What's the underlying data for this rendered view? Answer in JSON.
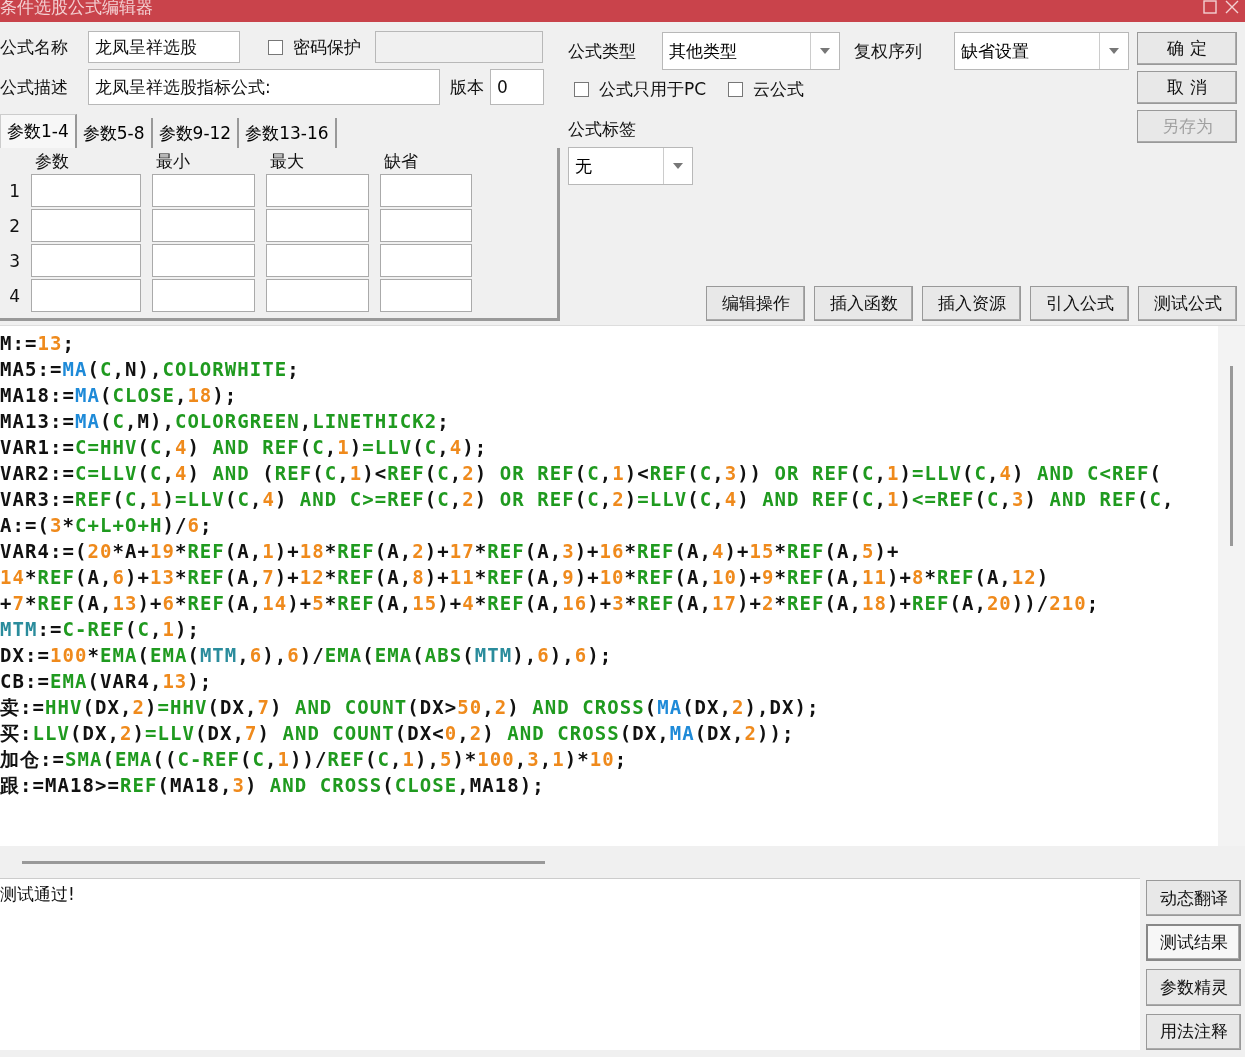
{
  "window": {
    "title": "条件选股公式编辑器"
  },
  "form": {
    "name_label": "公式名称",
    "name_value": "龙凤呈祥选股",
    "password": {
      "label": "密码保护",
      "checked": false
    },
    "desc_label": "公式描述",
    "desc_value": "龙凤呈祥选股指标公式:",
    "version_label": "版本",
    "version_value": "0",
    "type_label": "公式类型",
    "type_value": "其他类型",
    "rights_label": "复权序列",
    "rights_value": "缺省设置",
    "options": [
      {
        "label": "公式只用于PC",
        "checked": false
      },
      {
        "label": "云公式",
        "checked": false
      }
    ],
    "tag_label": "公式标签",
    "tag_value": "无"
  },
  "action_buttons": [
    {
      "label": "确 定",
      "disabled": false
    },
    {
      "label": "取 消",
      "disabled": false
    },
    {
      "label": "另存为",
      "disabled": true
    }
  ],
  "tabs": [
    {
      "label": "参数1-4",
      "selected": true
    },
    {
      "label": "参数5-8",
      "selected": false
    },
    {
      "label": "参数9-12",
      "selected": false
    },
    {
      "label": "参数13-16",
      "selected": false
    }
  ],
  "params": {
    "columns": [
      "参数",
      "最小",
      "最大",
      "缺省"
    ],
    "rows": [
      {
        "number": "1"
      },
      {
        "number": "2"
      },
      {
        "number": "3"
      },
      {
        "number": "4"
      }
    ]
  },
  "tool_buttons": [
    "编辑操作",
    "插入函数",
    "插入资源",
    "引入公式",
    "测试公式"
  ],
  "code_lines": [
    {
      "segments": [
        {
          "kind": "t",
          "text": "M:="
        },
        {
          "kind": "n",
          "text": "13"
        },
        {
          "kind": "t",
          "text": ";"
        }
      ]
    },
    {
      "segments": [
        {
          "kind": "t",
          "text": "MA5:="
        },
        {
          "kind": "m",
          "text": "MA"
        },
        {
          "kind": "t",
          "text": "("
        },
        {
          "kind": "f",
          "text": "C"
        },
        {
          "kind": "t",
          "text": ",N),"
        },
        {
          "kind": "f",
          "text": "COLORWHITE"
        },
        {
          "kind": "t",
          "text": ";"
        }
      ]
    },
    {
      "segments": [
        {
          "kind": "t",
          "text": "MA18:="
        },
        {
          "kind": "m",
          "text": "MA"
        },
        {
          "kind": "t",
          "text": "("
        },
        {
          "kind": "f",
          "text": "CLOSE"
        },
        {
          "kind": "t",
          "text": ","
        },
        {
          "kind": "n",
          "text": "18"
        },
        {
          "kind": "t",
          "text": ");"
        }
      ]
    },
    {
      "segments": [
        {
          "kind": "t",
          "text": "MA13:="
        },
        {
          "kind": "m",
          "text": "MA"
        },
        {
          "kind": "t",
          "text": "("
        },
        {
          "kind": "f",
          "text": "C"
        },
        {
          "kind": "t",
          "text": ",M),"
        },
        {
          "kind": "f",
          "text": "COLORGREEN"
        },
        {
          "kind": "t",
          "text": ","
        },
        {
          "kind": "f",
          "text": "LINETHICK2"
        },
        {
          "kind": "t",
          "text": ";"
        }
      ]
    },
    {
      "segments": [
        {
          "kind": "t",
          "text": "VAR1:="
        },
        {
          "kind": "f",
          "text": "C=HHV"
        },
        {
          "kind": "t",
          "text": "("
        },
        {
          "kind": "f",
          "text": "C"
        },
        {
          "kind": "t",
          "text": ","
        },
        {
          "kind": "n",
          "text": "4"
        },
        {
          "kind": "t",
          "text": ") "
        },
        {
          "kind": "f",
          "text": "AND REF"
        },
        {
          "kind": "t",
          "text": "("
        },
        {
          "kind": "f",
          "text": "C"
        },
        {
          "kind": "t",
          "text": ","
        },
        {
          "kind": "n",
          "text": "1"
        },
        {
          "kind": "t",
          "text": ")"
        },
        {
          "kind": "f",
          "text": "=LLV"
        },
        {
          "kind": "t",
          "text": "("
        },
        {
          "kind": "f",
          "text": "C"
        },
        {
          "kind": "t",
          "text": ","
        },
        {
          "kind": "n",
          "text": "4"
        },
        {
          "kind": "t",
          "text": ");"
        }
      ]
    },
    {
      "segments": [
        {
          "kind": "t",
          "text": "VAR2:="
        },
        {
          "kind": "f",
          "text": "C=LLV"
        },
        {
          "kind": "t",
          "text": "("
        },
        {
          "kind": "f",
          "text": "C"
        },
        {
          "kind": "t",
          "text": ","
        },
        {
          "kind": "n",
          "text": "4"
        },
        {
          "kind": "t",
          "text": ") "
        },
        {
          "kind": "f",
          "text": "AND"
        },
        {
          "kind": "t",
          "text": " ("
        },
        {
          "kind": "f",
          "text": "REF"
        },
        {
          "kind": "t",
          "text": "("
        },
        {
          "kind": "f",
          "text": "C"
        },
        {
          "kind": "t",
          "text": ","
        },
        {
          "kind": "n",
          "text": "1"
        },
        {
          "kind": "t",
          "text": ")<"
        },
        {
          "kind": "f",
          "text": "REF"
        },
        {
          "kind": "t",
          "text": "("
        },
        {
          "kind": "f",
          "text": "C"
        },
        {
          "kind": "t",
          "text": ","
        },
        {
          "kind": "n",
          "text": "2"
        },
        {
          "kind": "t",
          "text": ") "
        },
        {
          "kind": "f",
          "text": "OR REF"
        },
        {
          "kind": "t",
          "text": "("
        },
        {
          "kind": "f",
          "text": "C"
        },
        {
          "kind": "t",
          "text": ","
        },
        {
          "kind": "n",
          "text": "1"
        },
        {
          "kind": "t",
          "text": ")<"
        },
        {
          "kind": "f",
          "text": "REF"
        },
        {
          "kind": "t",
          "text": "("
        },
        {
          "kind": "f",
          "text": "C"
        },
        {
          "kind": "t",
          "text": ","
        },
        {
          "kind": "n",
          "text": "3"
        },
        {
          "kind": "t",
          "text": ")) "
        },
        {
          "kind": "f",
          "text": "OR REF"
        },
        {
          "kind": "t",
          "text": "("
        },
        {
          "kind": "f",
          "text": "C"
        },
        {
          "kind": "t",
          "text": ","
        },
        {
          "kind": "n",
          "text": "1"
        },
        {
          "kind": "t",
          "text": ")"
        },
        {
          "kind": "f",
          "text": "=LLV"
        },
        {
          "kind": "t",
          "text": "("
        },
        {
          "kind": "f",
          "text": "C"
        },
        {
          "kind": "t",
          "text": ","
        },
        {
          "kind": "n",
          "text": "4"
        },
        {
          "kind": "t",
          "text": ") "
        },
        {
          "kind": "f",
          "text": "AND C<REF"
        },
        {
          "kind": "t",
          "text": "("
        }
      ]
    },
    {
      "segments": [
        {
          "kind": "t",
          "text": "VAR3:="
        },
        {
          "kind": "f",
          "text": "REF"
        },
        {
          "kind": "t",
          "text": "("
        },
        {
          "kind": "f",
          "text": "C"
        },
        {
          "kind": "t",
          "text": ","
        },
        {
          "kind": "n",
          "text": "1"
        },
        {
          "kind": "t",
          "text": ")"
        },
        {
          "kind": "f",
          "text": "=LLV"
        },
        {
          "kind": "t",
          "text": "("
        },
        {
          "kind": "f",
          "text": "C"
        },
        {
          "kind": "t",
          "text": ","
        },
        {
          "kind": "n",
          "text": "4"
        },
        {
          "kind": "t",
          "text": ") "
        },
        {
          "kind": "f",
          "text": "AND C>=REF"
        },
        {
          "kind": "t",
          "text": "("
        },
        {
          "kind": "f",
          "text": "C"
        },
        {
          "kind": "t",
          "text": ","
        },
        {
          "kind": "n",
          "text": "2"
        },
        {
          "kind": "t",
          "text": ") "
        },
        {
          "kind": "f",
          "text": "OR REF"
        },
        {
          "kind": "t",
          "text": "("
        },
        {
          "kind": "f",
          "text": "C"
        },
        {
          "kind": "t",
          "text": ","
        },
        {
          "kind": "n",
          "text": "2"
        },
        {
          "kind": "t",
          "text": ")"
        },
        {
          "kind": "f",
          "text": "=LLV"
        },
        {
          "kind": "t",
          "text": "("
        },
        {
          "kind": "f",
          "text": "C"
        },
        {
          "kind": "t",
          "text": ","
        },
        {
          "kind": "n",
          "text": "4"
        },
        {
          "kind": "t",
          "text": ") "
        },
        {
          "kind": "f",
          "text": "AND REF"
        },
        {
          "kind": "t",
          "text": "("
        },
        {
          "kind": "f",
          "text": "C"
        },
        {
          "kind": "t",
          "text": ","
        },
        {
          "kind": "n",
          "text": "1"
        },
        {
          "kind": "t",
          "text": ")"
        },
        {
          "kind": "f",
          "text": "<=REF"
        },
        {
          "kind": "t",
          "text": "("
        },
        {
          "kind": "f",
          "text": "C"
        },
        {
          "kind": "t",
          "text": ","
        },
        {
          "kind": "n",
          "text": "3"
        },
        {
          "kind": "t",
          "text": ") "
        },
        {
          "kind": "f",
          "text": "AND REF"
        },
        {
          "kind": "t",
          "text": "("
        },
        {
          "kind": "f",
          "text": "C"
        },
        {
          "kind": "t",
          "text": ","
        }
      ]
    },
    {
      "segments": [
        {
          "kind": "t",
          "text": "A:=("
        },
        {
          "kind": "n",
          "text": "3"
        },
        {
          "kind": "t",
          "text": "*"
        },
        {
          "kind": "f",
          "text": "C+L+O+H"
        },
        {
          "kind": "t",
          "text": ")/"
        },
        {
          "kind": "n",
          "text": "6"
        },
        {
          "kind": "t",
          "text": ";"
        }
      ]
    },
    {
      "segments": [
        {
          "kind": "t",
          "text": "VAR4:=("
        },
        {
          "kind": "n",
          "text": "20"
        },
        {
          "kind": "t",
          "text": "*A+"
        },
        {
          "kind": "n",
          "text": "19"
        },
        {
          "kind": "t",
          "text": "*"
        },
        {
          "kind": "f",
          "text": "REF"
        },
        {
          "kind": "t",
          "text": "(A,"
        },
        {
          "kind": "n",
          "text": "1"
        },
        {
          "kind": "t",
          "text": ")+"
        },
        {
          "kind": "n",
          "text": "18"
        },
        {
          "kind": "t",
          "text": "*"
        },
        {
          "kind": "f",
          "text": "REF"
        },
        {
          "kind": "t",
          "text": "(A,"
        },
        {
          "kind": "n",
          "text": "2"
        },
        {
          "kind": "t",
          "text": ")+"
        },
        {
          "kind": "n",
          "text": "17"
        },
        {
          "kind": "t",
          "text": "*"
        },
        {
          "kind": "f",
          "text": "REF"
        },
        {
          "kind": "t",
          "text": "(A,"
        },
        {
          "kind": "n",
          "text": "3"
        },
        {
          "kind": "t",
          "text": ")+"
        },
        {
          "kind": "n",
          "text": "16"
        },
        {
          "kind": "t",
          "text": "*"
        },
        {
          "kind": "f",
          "text": "REF"
        },
        {
          "kind": "t",
          "text": "(A,"
        },
        {
          "kind": "n",
          "text": "4"
        },
        {
          "kind": "t",
          "text": ")+"
        },
        {
          "kind": "n",
          "text": "15"
        },
        {
          "kind": "t",
          "text": "*"
        },
        {
          "kind": "f",
          "text": "REF"
        },
        {
          "kind": "t",
          "text": "(A,"
        },
        {
          "kind": "n",
          "text": "5"
        },
        {
          "kind": "t",
          "text": ")+"
        }
      ]
    },
    {
      "segments": [
        {
          "kind": "n",
          "text": "14"
        },
        {
          "kind": "t",
          "text": "*"
        },
        {
          "kind": "f",
          "text": "REF"
        },
        {
          "kind": "t",
          "text": "(A,"
        },
        {
          "kind": "n",
          "text": "6"
        },
        {
          "kind": "t",
          "text": ")+"
        },
        {
          "kind": "n",
          "text": "13"
        },
        {
          "kind": "t",
          "text": "*"
        },
        {
          "kind": "f",
          "text": "REF"
        },
        {
          "kind": "t",
          "text": "(A,"
        },
        {
          "kind": "n",
          "text": "7"
        },
        {
          "kind": "t",
          "text": ")+"
        },
        {
          "kind": "n",
          "text": "12"
        },
        {
          "kind": "t",
          "text": "*"
        },
        {
          "kind": "f",
          "text": "REF"
        },
        {
          "kind": "t",
          "text": "(A,"
        },
        {
          "kind": "n",
          "text": "8"
        },
        {
          "kind": "t",
          "text": ")+"
        },
        {
          "kind": "n",
          "text": "11"
        },
        {
          "kind": "t",
          "text": "*"
        },
        {
          "kind": "f",
          "text": "REF"
        },
        {
          "kind": "t",
          "text": "(A,"
        },
        {
          "kind": "n",
          "text": "9"
        },
        {
          "kind": "t",
          "text": ")+"
        },
        {
          "kind": "n",
          "text": "10"
        },
        {
          "kind": "t",
          "text": "*"
        },
        {
          "kind": "f",
          "text": "REF"
        },
        {
          "kind": "t",
          "text": "(A,"
        },
        {
          "kind": "n",
          "text": "10"
        },
        {
          "kind": "t",
          "text": ")+"
        },
        {
          "kind": "n",
          "text": "9"
        },
        {
          "kind": "t",
          "text": "*"
        },
        {
          "kind": "f",
          "text": "REF"
        },
        {
          "kind": "t",
          "text": "(A,"
        },
        {
          "kind": "n",
          "text": "11"
        },
        {
          "kind": "t",
          "text": ")+"
        },
        {
          "kind": "n",
          "text": "8"
        },
        {
          "kind": "t",
          "text": "*"
        },
        {
          "kind": "f",
          "text": "REF"
        },
        {
          "kind": "t",
          "text": "(A,"
        },
        {
          "kind": "n",
          "text": "12"
        },
        {
          "kind": "t",
          "text": ")"
        }
      ]
    },
    {
      "segments": [
        {
          "kind": "t",
          "text": "+"
        },
        {
          "kind": "n",
          "text": "7"
        },
        {
          "kind": "t",
          "text": "*"
        },
        {
          "kind": "f",
          "text": "REF"
        },
        {
          "kind": "t",
          "text": "(A,"
        },
        {
          "kind": "n",
          "text": "13"
        },
        {
          "kind": "t",
          "text": ")+"
        },
        {
          "kind": "n",
          "text": "6"
        },
        {
          "kind": "t",
          "text": "*"
        },
        {
          "kind": "f",
          "text": "REF"
        },
        {
          "kind": "t",
          "text": "(A,"
        },
        {
          "kind": "n",
          "text": "14"
        },
        {
          "kind": "t",
          "text": ")+"
        },
        {
          "kind": "n",
          "text": "5"
        },
        {
          "kind": "t",
          "text": "*"
        },
        {
          "kind": "f",
          "text": "REF"
        },
        {
          "kind": "t",
          "text": "(A,"
        },
        {
          "kind": "n",
          "text": "15"
        },
        {
          "kind": "t",
          "text": ")+"
        },
        {
          "kind": "n",
          "text": "4"
        },
        {
          "kind": "t",
          "text": "*"
        },
        {
          "kind": "f",
          "text": "REF"
        },
        {
          "kind": "t",
          "text": "(A,"
        },
        {
          "kind": "n",
          "text": "16"
        },
        {
          "kind": "t",
          "text": ")+"
        },
        {
          "kind": "n",
          "text": "3"
        },
        {
          "kind": "t",
          "text": "*"
        },
        {
          "kind": "f",
          "text": "REF"
        },
        {
          "kind": "t",
          "text": "(A,"
        },
        {
          "kind": "n",
          "text": "17"
        },
        {
          "kind": "t",
          "text": ")+"
        },
        {
          "kind": "n",
          "text": "2"
        },
        {
          "kind": "t",
          "text": "*"
        },
        {
          "kind": "f",
          "text": "REF"
        },
        {
          "kind": "t",
          "text": "(A,"
        },
        {
          "kind": "n",
          "text": "18"
        },
        {
          "kind": "t",
          "text": ")+"
        },
        {
          "kind": "f",
          "text": "REF"
        },
        {
          "kind": "t",
          "text": "(A,"
        },
        {
          "kind": "n",
          "text": "20"
        },
        {
          "kind": "t",
          "text": "))/"
        },
        {
          "kind": "n",
          "text": "210"
        },
        {
          "kind": "t",
          "text": ";"
        }
      ]
    },
    {
      "segments": [
        {
          "kind": "v",
          "text": "MTM"
        },
        {
          "kind": "t",
          "text": ":="
        },
        {
          "kind": "f",
          "text": "C-REF"
        },
        {
          "kind": "t",
          "text": "("
        },
        {
          "kind": "f",
          "text": "C"
        },
        {
          "kind": "t",
          "text": ","
        },
        {
          "kind": "n",
          "text": "1"
        },
        {
          "kind": "t",
          "text": ");"
        }
      ]
    },
    {
      "segments": [
        {
          "kind": "t",
          "text": "DX:="
        },
        {
          "kind": "n",
          "text": "100"
        },
        {
          "kind": "t",
          "text": "*"
        },
        {
          "kind": "f",
          "text": "EMA"
        },
        {
          "kind": "t",
          "text": "("
        },
        {
          "kind": "f",
          "text": "EMA"
        },
        {
          "kind": "t",
          "text": "("
        },
        {
          "kind": "v",
          "text": "MTM"
        },
        {
          "kind": "t",
          "text": ","
        },
        {
          "kind": "n",
          "text": "6"
        },
        {
          "kind": "t",
          "text": "),"
        },
        {
          "kind": "n",
          "text": "6"
        },
        {
          "kind": "t",
          "text": ")/"
        },
        {
          "kind": "f",
          "text": "EMA"
        },
        {
          "kind": "t",
          "text": "("
        },
        {
          "kind": "f",
          "text": "EMA"
        },
        {
          "kind": "t",
          "text": "("
        },
        {
          "kind": "f",
          "text": "ABS"
        },
        {
          "kind": "t",
          "text": "("
        },
        {
          "kind": "v",
          "text": "MTM"
        },
        {
          "kind": "t",
          "text": "),"
        },
        {
          "kind": "n",
          "text": "6"
        },
        {
          "kind": "t",
          "text": "),"
        },
        {
          "kind": "n",
          "text": "6"
        },
        {
          "kind": "t",
          "text": ");"
        }
      ]
    },
    {
      "segments": [
        {
          "kind": "t",
          "text": "CB:="
        },
        {
          "kind": "f",
          "text": "EMA"
        },
        {
          "kind": "t",
          "text": "(VAR4,"
        },
        {
          "kind": "n",
          "text": "13"
        },
        {
          "kind": "t",
          "text": ");"
        }
      ]
    },
    {
      "segments": [
        {
          "kind": "t",
          "text": "卖:="
        },
        {
          "kind": "f",
          "text": "HHV"
        },
        {
          "kind": "t",
          "text": "(DX,"
        },
        {
          "kind": "n",
          "text": "2"
        },
        {
          "kind": "t",
          "text": ")"
        },
        {
          "kind": "f",
          "text": "=HHV"
        },
        {
          "kind": "t",
          "text": "(DX,"
        },
        {
          "kind": "n",
          "text": "7"
        },
        {
          "kind": "t",
          "text": ") "
        },
        {
          "kind": "f",
          "text": "AND COUNT"
        },
        {
          "kind": "t",
          "text": "(DX>"
        },
        {
          "kind": "n",
          "text": "50"
        },
        {
          "kind": "t",
          "text": ","
        },
        {
          "kind": "n",
          "text": "2"
        },
        {
          "kind": "t",
          "text": ") "
        },
        {
          "kind": "f",
          "text": "AND CROSS"
        },
        {
          "kind": "t",
          "text": "("
        },
        {
          "kind": "m",
          "text": "MA"
        },
        {
          "kind": "t",
          "text": "(DX,"
        },
        {
          "kind": "n",
          "text": "2"
        },
        {
          "kind": "t",
          "text": "),DX);"
        }
      ]
    },
    {
      "segments": [
        {
          "kind": "t",
          "text": "买:"
        },
        {
          "kind": "f",
          "text": "LLV"
        },
        {
          "kind": "t",
          "text": "(DX,"
        },
        {
          "kind": "n",
          "text": "2"
        },
        {
          "kind": "t",
          "text": ")"
        },
        {
          "kind": "f",
          "text": "=LLV"
        },
        {
          "kind": "t",
          "text": "(DX,"
        },
        {
          "kind": "n",
          "text": "7"
        },
        {
          "kind": "t",
          "text": ") "
        },
        {
          "kind": "f",
          "text": "AND COUNT"
        },
        {
          "kind": "t",
          "text": "(DX<"
        },
        {
          "kind": "n",
          "text": "0"
        },
        {
          "kind": "t",
          "text": ","
        },
        {
          "kind": "n",
          "text": "2"
        },
        {
          "kind": "t",
          "text": ") "
        },
        {
          "kind": "f",
          "text": "AND CROSS"
        },
        {
          "kind": "t",
          "text": "(DX,"
        },
        {
          "kind": "m",
          "text": "MA"
        },
        {
          "kind": "t",
          "text": "(DX,"
        },
        {
          "kind": "n",
          "text": "2"
        },
        {
          "kind": "t",
          "text": "));"
        }
      ]
    },
    {
      "segments": [
        {
          "kind": "t",
          "text": "加仓:="
        },
        {
          "kind": "f",
          "text": "SMA"
        },
        {
          "kind": "t",
          "text": "("
        },
        {
          "kind": "f",
          "text": "EMA"
        },
        {
          "kind": "t",
          "text": "(("
        },
        {
          "kind": "f",
          "text": "C-REF"
        },
        {
          "kind": "t",
          "text": "("
        },
        {
          "kind": "f",
          "text": "C"
        },
        {
          "kind": "t",
          "text": ","
        },
        {
          "kind": "n",
          "text": "1"
        },
        {
          "kind": "t",
          "text": "))/"
        },
        {
          "kind": "f",
          "text": "REF"
        },
        {
          "kind": "t",
          "text": "("
        },
        {
          "kind": "f",
          "text": "C"
        },
        {
          "kind": "t",
          "text": ","
        },
        {
          "kind": "n",
          "text": "1"
        },
        {
          "kind": "t",
          "text": "),"
        },
        {
          "kind": "n",
          "text": "5"
        },
        {
          "kind": "t",
          "text": ")*"
        },
        {
          "kind": "n",
          "text": "100"
        },
        {
          "kind": "t",
          "text": ","
        },
        {
          "kind": "n",
          "text": "3"
        },
        {
          "kind": "t",
          "text": ","
        },
        {
          "kind": "n",
          "text": "1"
        },
        {
          "kind": "t",
          "text": ")*"
        },
        {
          "kind": "n",
          "text": "10"
        },
        {
          "kind": "t",
          "text": ";"
        }
      ]
    },
    {
      "segments": [
        {
          "kind": "t",
          "text": "跟:=MA18>="
        },
        {
          "kind": "f",
          "text": "REF"
        },
        {
          "kind": "t",
          "text": "(MA18,"
        },
        {
          "kind": "n",
          "text": "3"
        },
        {
          "kind": "t",
          "text": ") "
        },
        {
          "kind": "f",
          "text": "AND CROSS"
        },
        {
          "kind": "t",
          "text": "("
        },
        {
          "kind": "f",
          "text": "CLOSE"
        },
        {
          "kind": "t",
          "text": ",MA18);"
        }
      ]
    }
  ],
  "output": {
    "text": "测试通过!"
  },
  "side_buttons": [
    {
      "label": "动态翻译",
      "selected": false
    },
    {
      "label": "测试结果",
      "selected": true
    },
    {
      "label": "参数精灵",
      "selected": false
    },
    {
      "label": "用法注释",
      "selected": false
    }
  ]
}
